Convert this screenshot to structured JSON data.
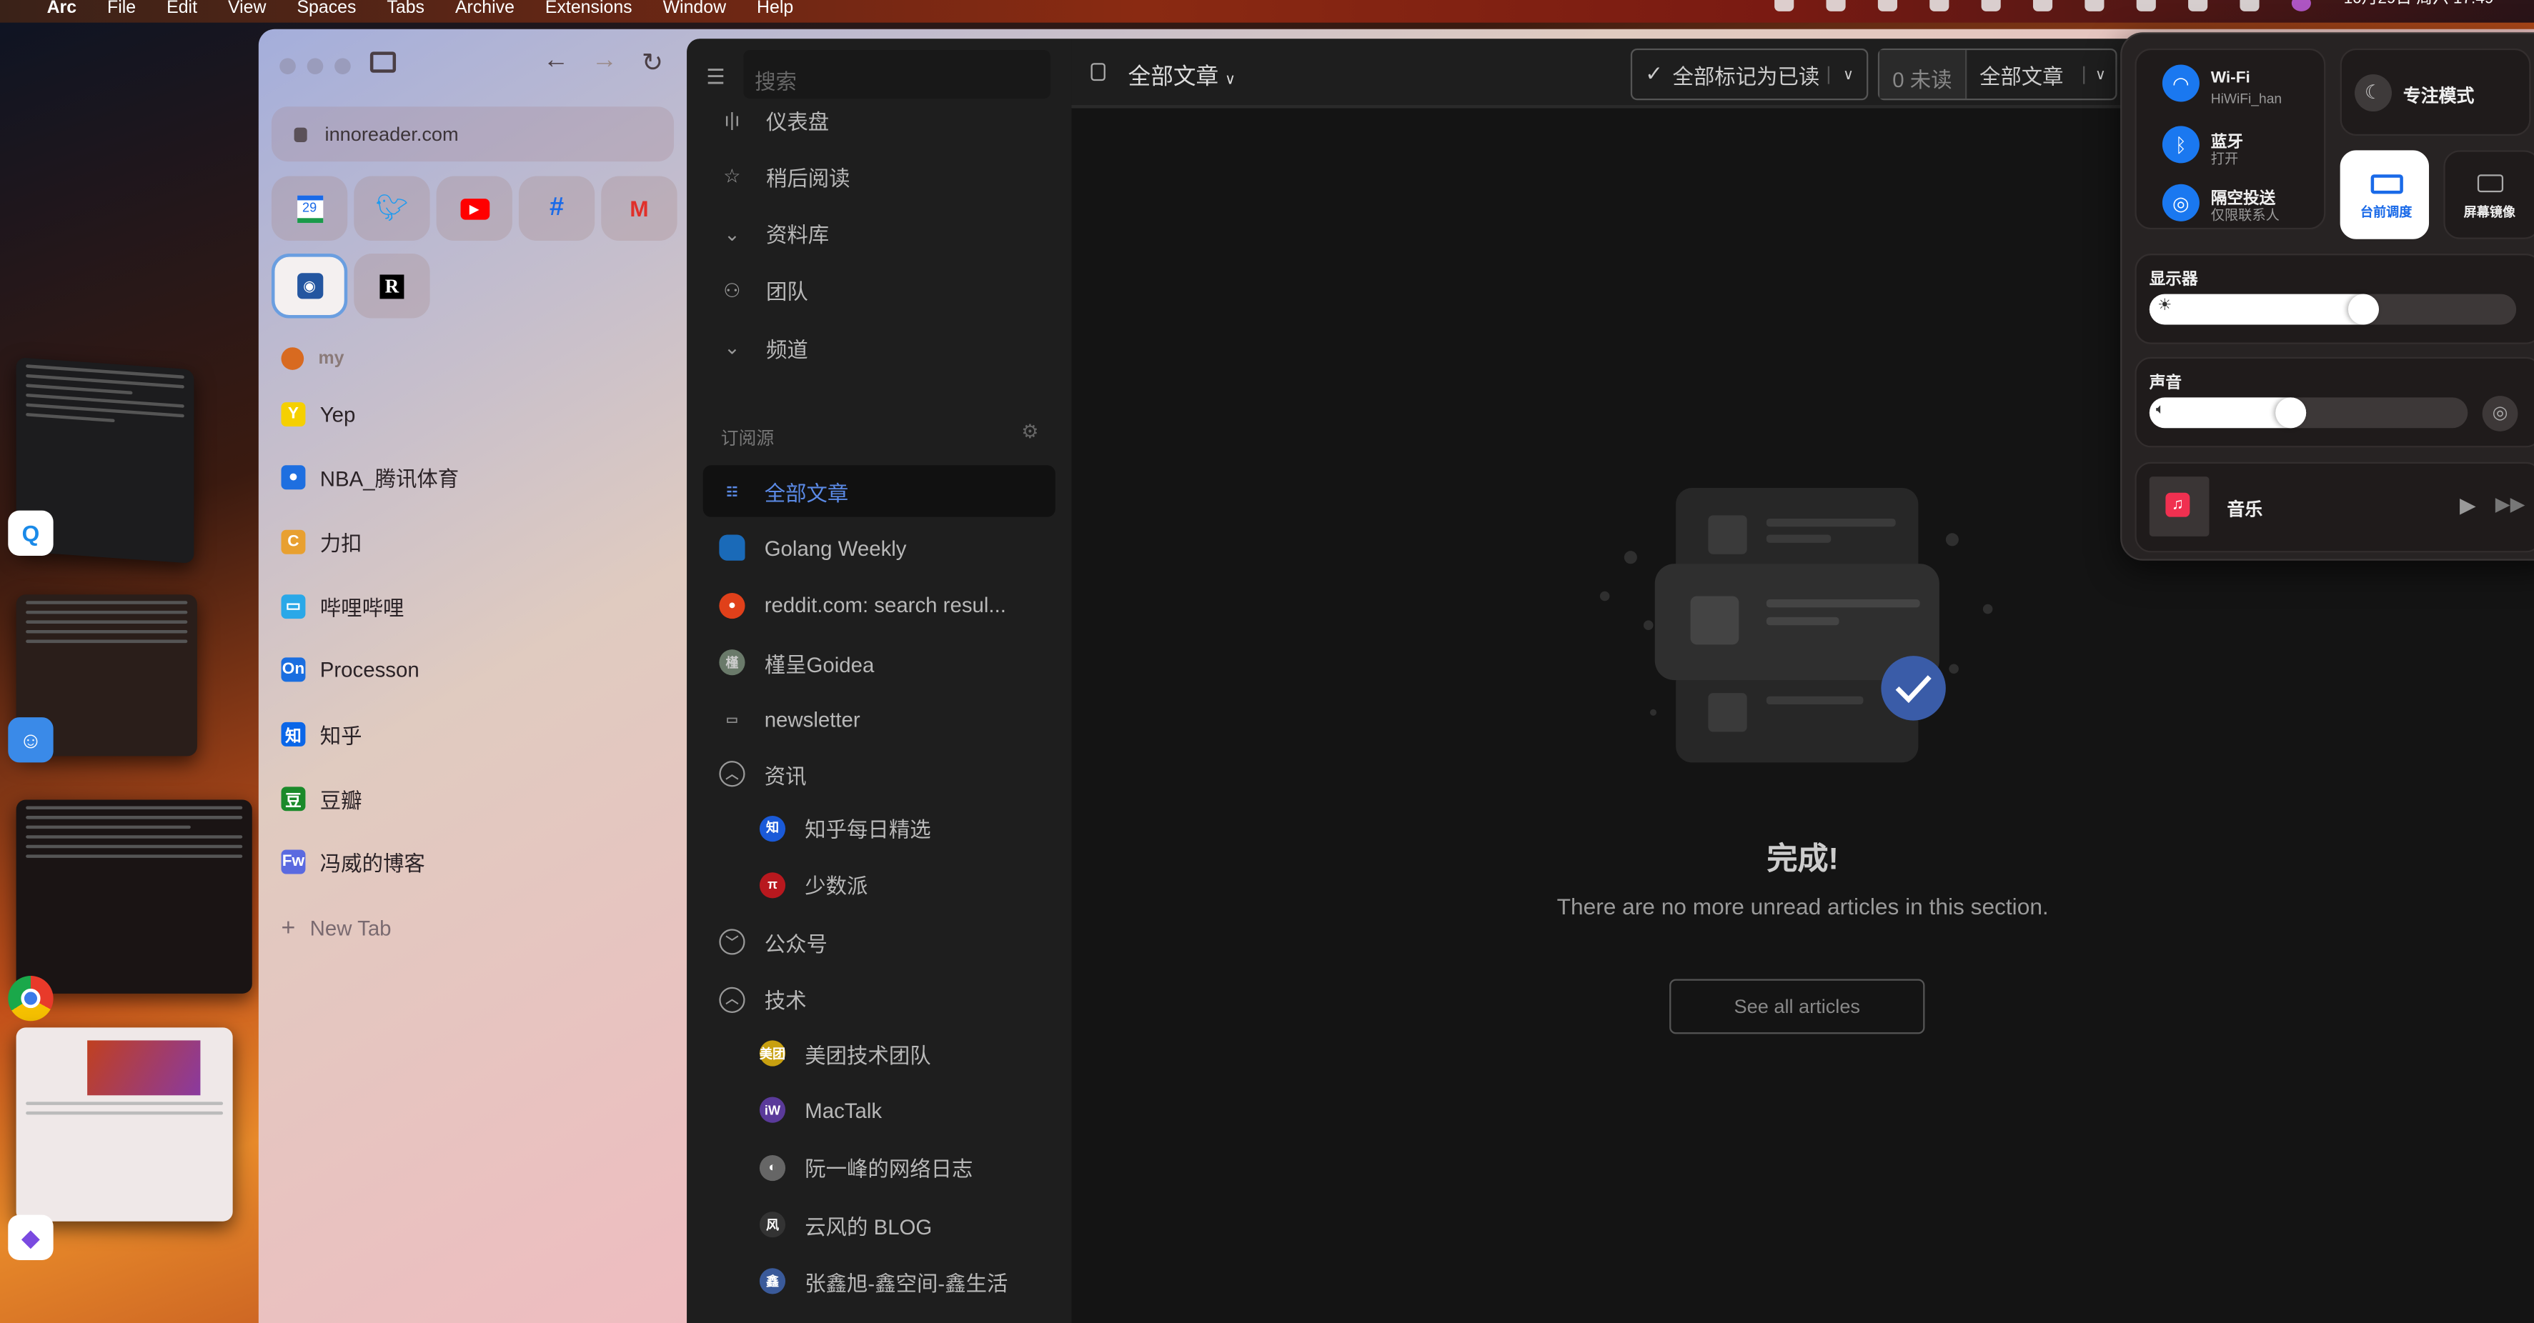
{
  "menubar": {
    "app": "Arc",
    "items": [
      "File",
      "Edit",
      "View",
      "Spaces",
      "Tabs",
      "Archive",
      "Extensions",
      "Window",
      "Help"
    ],
    "datetime": "10月29日 周六 17:49"
  },
  "arc": {
    "url": "innoreader.com",
    "favorites": [
      "google-calendar",
      "twitter",
      "youtube",
      "slack",
      "gmail",
      "inoreader",
      "readwise"
    ],
    "calendar_day": "29",
    "folder": "my",
    "tabs": [
      {
        "label": "Yep",
        "icon": "Y",
        "color": "#f5d000"
      },
      {
        "label": "NBA_腾讯体育",
        "icon": "●",
        "color": "#1e6fe0"
      },
      {
        "label": "力扣",
        "icon": "C",
        "color": "#e8a030"
      },
      {
        "label": "哔哩哔哩",
        "icon": "▭",
        "color": "#2aa8e8"
      },
      {
        "label": "Processon",
        "icon": "On",
        "color": "#1a6ee0"
      },
      {
        "label": "知乎",
        "icon": "知",
        "color": "#0a66e8"
      },
      {
        "label": "豆瓣",
        "icon": "豆",
        "color": "#1a8a2a"
      },
      {
        "label": "冯威的博客",
        "icon": "Fw",
        "color": "#5a6ae0"
      }
    ],
    "new_tab": "New Tab"
  },
  "reader": {
    "search_placeholder": "搜索",
    "nav": [
      {
        "label": "仪表盘",
        "icon": "chart-icon"
      },
      {
        "label": "稍后阅读",
        "icon": "star-icon"
      },
      {
        "label": "资料库",
        "icon": "chevron-circle-icon"
      },
      {
        "label": "团队",
        "icon": "team-icon"
      },
      {
        "label": "频道",
        "icon": "chevron-circle-icon"
      }
    ],
    "feeds_heading": "订阅源",
    "feeds": [
      {
        "label": "全部文章",
        "selected": true
      },
      {
        "label": "Golang Weekly"
      },
      {
        "label": "reddit.com: search resul..."
      },
      {
        "label": "槿呈Goidea"
      },
      {
        "label": "newsletter"
      }
    ],
    "folders": [
      {
        "label": "资讯",
        "children": [
          {
            "label": "知乎每日精选",
            "icon": "知",
            "color": "#1a5ad8"
          },
          {
            "label": "少数派",
            "icon": "π",
            "color": "#b8181e"
          }
        ]
      },
      {
        "label": "公众号",
        "children": []
      },
      {
        "label": "技术",
        "children": [
          {
            "label": "美团技术团队",
            "icon": "美团",
            "color": "#c8a010"
          },
          {
            "label": "MacTalk",
            "icon": "iW",
            "color": "#5a3a9a"
          },
          {
            "label": "阮一峰的网络日志",
            "icon": "◐",
            "color": "#666"
          },
          {
            "label": "云风的 BLOG",
            "icon": "风",
            "color": "#333"
          },
          {
            "label": "张鑫旭-鑫空间-鑫生活",
            "icon": "鑫",
            "color": "#3a5a9a"
          }
        ]
      }
    ],
    "header": {
      "title": "全部文章",
      "mark_all_read": "全部标记为已读",
      "unread": "0 未读",
      "filter": "全部文章"
    },
    "empty": {
      "title": "完成!",
      "message": "There are no more unread articles in this section.",
      "button": "See all articles"
    },
    "accent": "#5b8ae6"
  },
  "control_center": {
    "wifi": {
      "label": "Wi-Fi",
      "sub": "HiWiFi_han"
    },
    "bluetooth": {
      "label": "蓝牙",
      "sub": "打开"
    },
    "airdrop": {
      "label": "隔空投送",
      "sub": "仅限联系人"
    },
    "focus": "专注模式",
    "stage_manager": "台前调度",
    "screen_mirror": "屏幕镜像",
    "display": {
      "label": "显示器",
      "level": 0.58
    },
    "sound": {
      "label": "声音",
      "level": 0.44
    },
    "music": "音乐"
  }
}
